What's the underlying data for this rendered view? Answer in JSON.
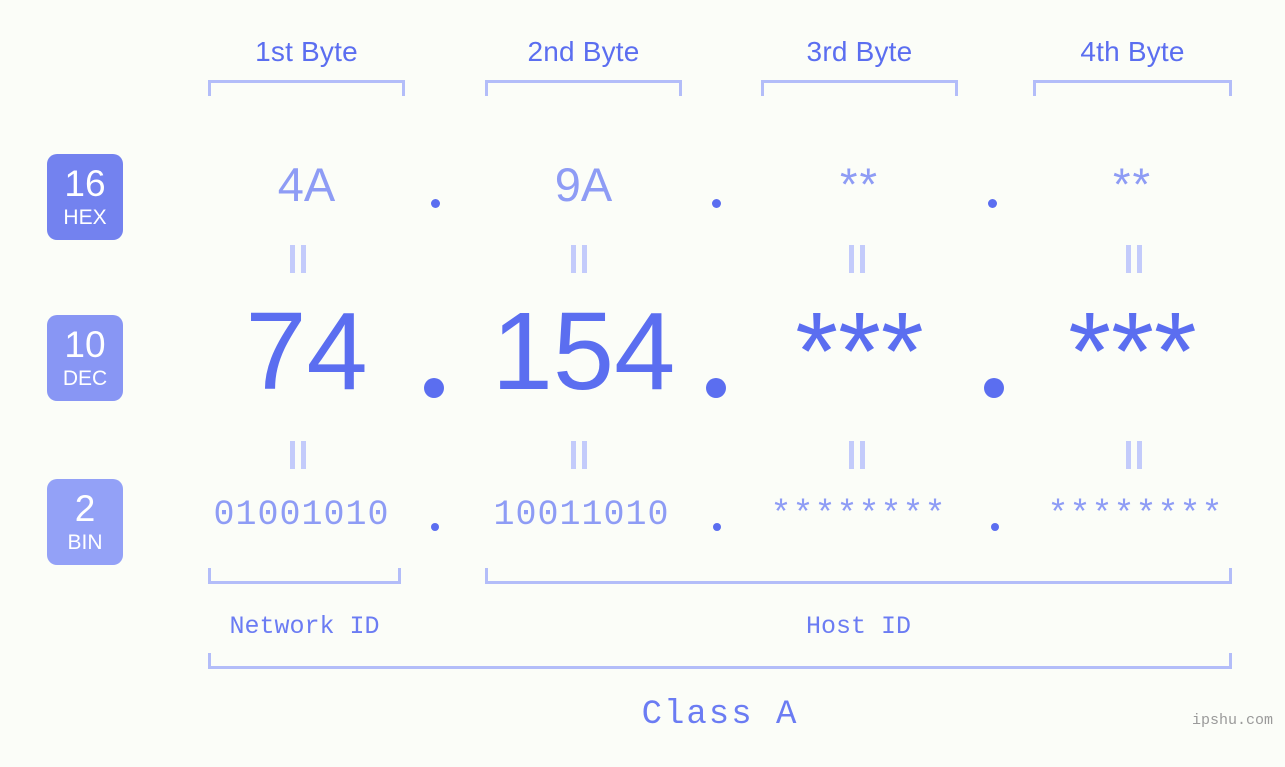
{
  "colors": {
    "background": "#fbfdf8",
    "accent_strong": "#5b6ef0",
    "accent_light": "#8e9cf5",
    "bracket": "#b3bdf9",
    "connector": "#c3cbfb",
    "badge_hex": "#7382ef",
    "badge_dec": "#8896f4",
    "badge_bin": "#93a1f7",
    "watermark": "#9a9a9a"
  },
  "header": {
    "byte_labels": [
      "1st Byte",
      "2nd Byte",
      "3rd Byte",
      "4th Byte"
    ]
  },
  "bases": [
    {
      "number": "16",
      "name": "HEX"
    },
    {
      "number": "10",
      "name": "DEC"
    },
    {
      "number": "2",
      "name": "BIN"
    }
  ],
  "rows": {
    "hex": {
      "base_number": "16",
      "base_name": "HEX",
      "values": [
        "4A",
        "9A",
        "**",
        "**"
      ],
      "separator": "."
    },
    "dec": {
      "base_number": "10",
      "base_name": "DEC",
      "values": [
        "74",
        "154",
        "***",
        "***"
      ],
      "separator": "."
    },
    "bin": {
      "base_number": "2",
      "base_name": "BIN",
      "values": [
        "01001010",
        "10011010",
        "********",
        "********"
      ],
      "separator": "."
    }
  },
  "connectors": {
    "glyph": "||",
    "meaning": "equals"
  },
  "footer": {
    "network_id_label": "Network ID",
    "host_id_label": "Host ID",
    "class_label": "Class A",
    "watermark": "ipshu.com"
  }
}
